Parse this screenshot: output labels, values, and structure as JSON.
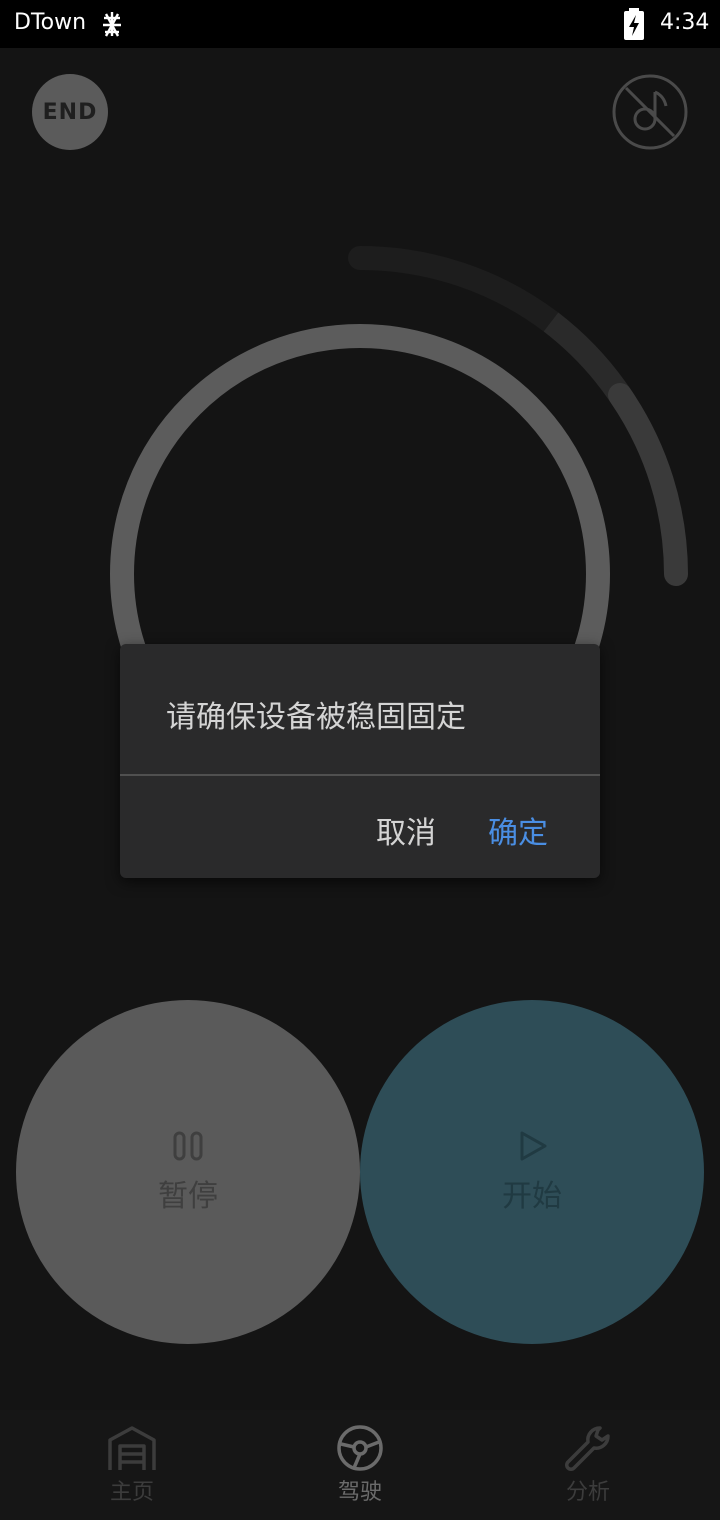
{
  "status_bar": {
    "carrier": "DTown",
    "time": "4:34"
  },
  "top": {
    "end_label": "END"
  },
  "dialog": {
    "message": "请确保设备被稳固固定",
    "cancel_label": "取消",
    "confirm_label": "确定"
  },
  "controls": {
    "pause_label": "暂停",
    "start_label": "开始"
  },
  "nav": {
    "items": [
      {
        "label": "主页",
        "icon": "garage-home-icon"
      },
      {
        "label": "驾驶",
        "icon": "steering-wheel-icon"
      },
      {
        "label": "分析",
        "icon": "wrench-icon"
      }
    ],
    "active_index": 1
  },
  "colors": {
    "accent": "#4a8ee3",
    "start_button": "#2e4d57",
    "pause_button": "#5a5a5a",
    "background": "#141414"
  }
}
